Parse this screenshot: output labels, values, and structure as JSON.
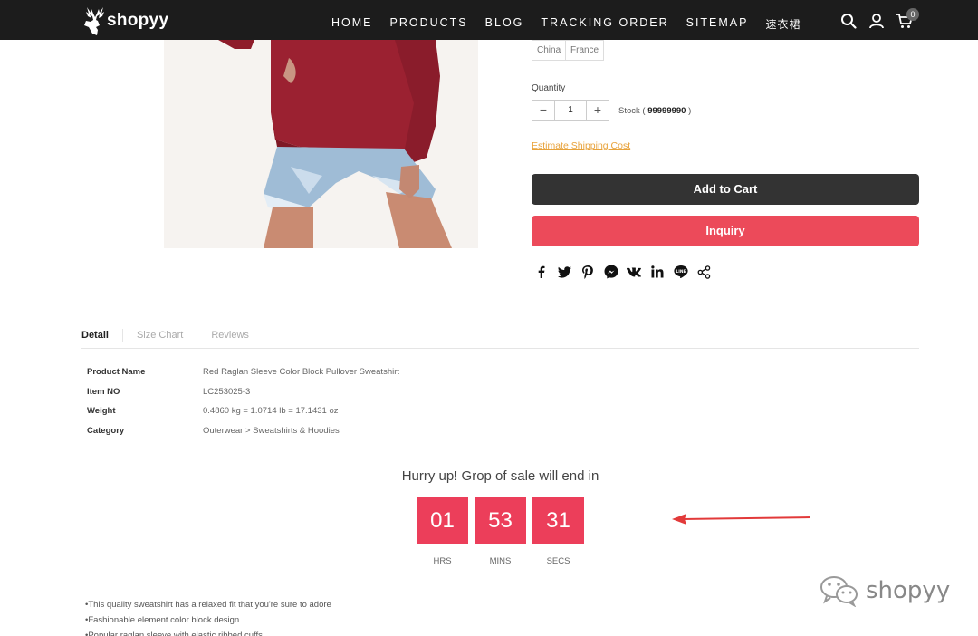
{
  "brand": {
    "name": "shopyy"
  },
  "nav": {
    "items": [
      "HOME",
      "PRODUCTS",
      "BLOG",
      "TRACKING ORDER",
      "SITEMAP",
      "速衣裙"
    ],
    "cart_count": "0"
  },
  "product": {
    "ship_from_options": [
      "China",
      "France"
    ],
    "quantity_label": "Quantity",
    "quantity_value": "1",
    "qty_minus": "−",
    "qty_plus": "+",
    "stock_prefix": "Stock ( ",
    "stock_value": "99999990",
    "stock_suffix": " )",
    "shipping_link": "Estimate Shipping Cost",
    "add_to_cart": "Add to Cart",
    "inquiry": "Inquiry"
  },
  "share_icons": [
    "facebook-icon",
    "twitter-icon",
    "pinterest-icon",
    "messenger-icon",
    "vk-icon",
    "linkedin-icon",
    "line-icon",
    "share-icon"
  ],
  "tabs": [
    "Detail",
    "Size Chart",
    "Reviews"
  ],
  "specs": [
    {
      "key": "Product Name",
      "value": "Red Raglan Sleeve Color Block Pullover Sweatshirt"
    },
    {
      "key": "Item NO",
      "value": "LC253025-3"
    },
    {
      "key": "Weight",
      "value": "0.4860 kg = 1.0714 lb = 17.1431 oz"
    },
    {
      "key": "Category",
      "value": "Outerwear > Sweatshirts & Hoodies"
    }
  ],
  "countdown": {
    "title": "Hurry up! Grop of sale will end in",
    "hours": "01",
    "minutes": "53",
    "seconds": "31",
    "hours_label": "HRS",
    "minutes_label": "MINS",
    "seconds_label": "SECS"
  },
  "description": [
    "•This quality sweatshirt has a relaxed fit that you're sure to adore",
    "•Fashionable element color block design",
    "•Popular raglan sleeve with elastic ribbed cuffs"
  ],
  "watermark": {
    "text": "shopyy"
  },
  "colors": {
    "header_bg": "#1c1c1c",
    "accent": "#ec3e5a",
    "cart_button": "#333333",
    "link": "#e8a23a"
  }
}
